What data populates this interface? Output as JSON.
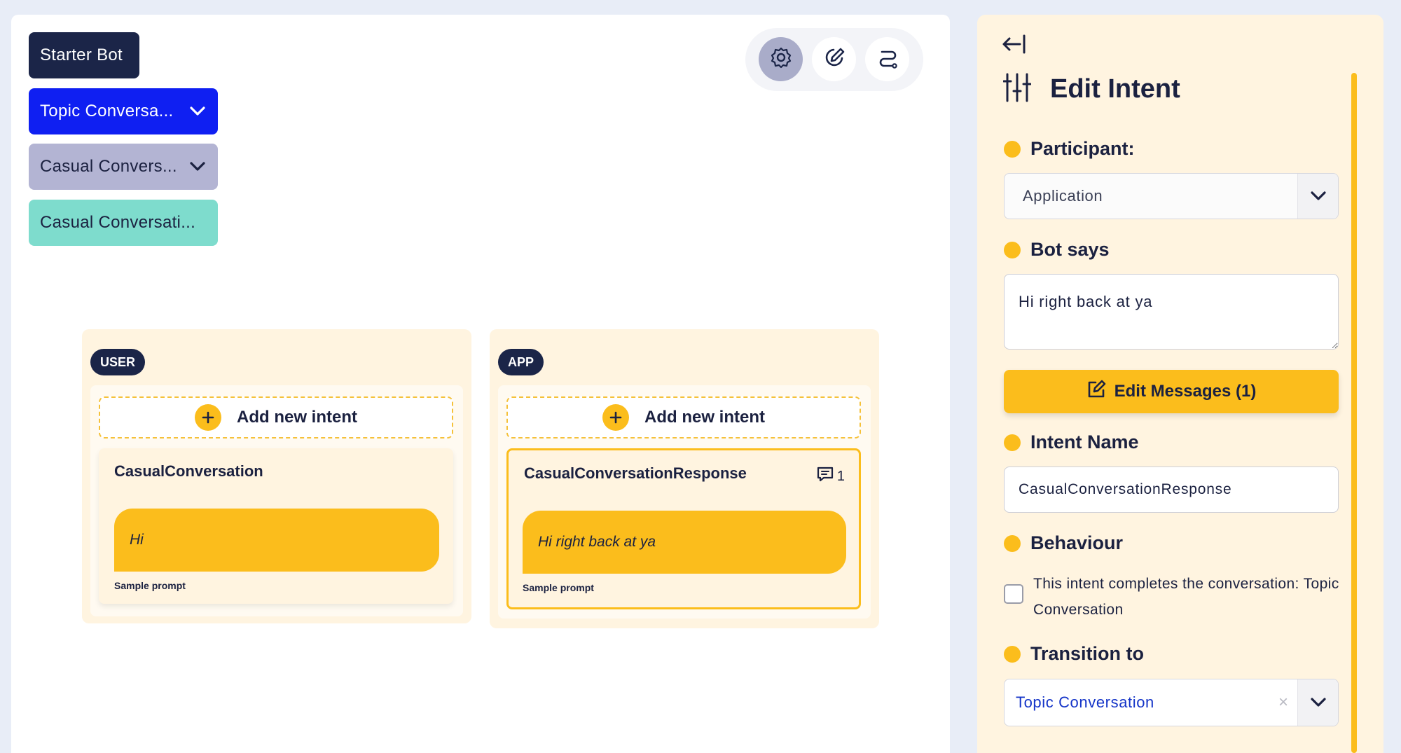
{
  "breadcrumbs": [
    {
      "label": "Starter Bot"
    },
    {
      "label": "Topic Conversa..."
    },
    {
      "label": "Casual Convers..."
    },
    {
      "label": "Casual Conversati..."
    }
  ],
  "toolbar": {
    "icons": [
      "settings-icon",
      "edit-icon",
      "flow-icon"
    ]
  },
  "user_column": {
    "tag": "USER",
    "add_label": "Add new intent",
    "intent_name": "CasualConversation",
    "prompt_text": "Hi",
    "sample_label": "Sample prompt"
  },
  "app_column": {
    "tag": "APP",
    "add_label": "Add new intent",
    "intent_name": "CasualConversationResponse",
    "message_count": "1",
    "prompt_text": "Hi right back at ya",
    "sample_label": "Sample prompt"
  },
  "panel": {
    "title": "Edit Intent",
    "participant_label": "Participant:",
    "participant_value": "Application",
    "bot_says_label": "Bot says",
    "bot_says_value": "Hi right back at ya",
    "edit_messages_label": "Edit Messages (1)",
    "intent_name_label": "Intent Name",
    "intent_name_value": "CasualConversationResponse",
    "behaviour_label": "Behaviour",
    "behaviour_checkbox_text": "This intent completes the conversation: Topic Conversation",
    "behaviour_checked": false,
    "transition_label": "Transition to",
    "transition_value": "Topic Conversation",
    "clear_symbol": "×"
  },
  "colors": {
    "accent": "#fbbd1c",
    "navy": "#1b2548",
    "topic_blue": "#0f1ff2",
    "casual_lavender": "#b3b4d3",
    "casual_teal": "#7edccd",
    "panel_bg": "#fff4e0"
  }
}
